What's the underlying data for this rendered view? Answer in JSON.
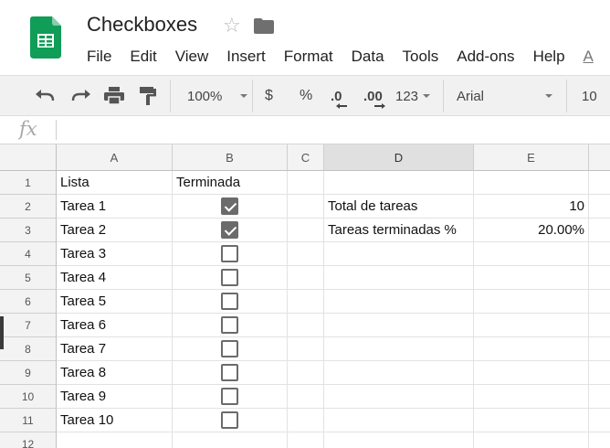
{
  "app": {
    "title": "Checkboxes",
    "menu": [
      "File",
      "Edit",
      "View",
      "Insert",
      "Format",
      "Data",
      "Tools",
      "Add-ons",
      "Help",
      "A"
    ]
  },
  "toolbar": {
    "zoom": "100%",
    "currency": "$",
    "percent": "%",
    "dec_decrease": ".0",
    "dec_increase": ".00",
    "number_format": "123",
    "font": "Arial",
    "font_size": "10"
  },
  "formula_bar": {
    "fx_label": "fx",
    "value": ""
  },
  "columns": [
    "A",
    "B",
    "C",
    "D",
    "E"
  ],
  "selected_column": "D",
  "rows": [
    {
      "num": "1",
      "a": "Lista",
      "b_text": "Terminada",
      "checkbox": null,
      "d": "",
      "e": ""
    },
    {
      "num": "2",
      "a": "Tarea 1",
      "b_text": "",
      "checkbox": true,
      "d": "Total de tareas",
      "e": "10"
    },
    {
      "num": "3",
      "a": "Tarea 2",
      "b_text": "",
      "checkbox": true,
      "d": "Tareas terminadas %",
      "e": "20.00%"
    },
    {
      "num": "4",
      "a": "Tarea 3",
      "b_text": "",
      "checkbox": false,
      "d": "",
      "e": ""
    },
    {
      "num": "5",
      "a": "Tarea 4",
      "b_text": "",
      "checkbox": false,
      "d": "",
      "e": ""
    },
    {
      "num": "6",
      "a": "Tarea 5",
      "b_text": "",
      "checkbox": false,
      "d": "",
      "e": ""
    },
    {
      "num": "7",
      "a": "Tarea 6",
      "b_text": "",
      "checkbox": false,
      "d": "",
      "e": ""
    },
    {
      "num": "8",
      "a": "Tarea 7",
      "b_text": "",
      "checkbox": false,
      "d": "",
      "e": ""
    },
    {
      "num": "9",
      "a": "Tarea 8",
      "b_text": "",
      "checkbox": false,
      "d": "",
      "e": ""
    },
    {
      "num": "10",
      "a": "Tarea 9",
      "b_text": "",
      "checkbox": false,
      "d": "",
      "e": ""
    },
    {
      "num": "11",
      "a": "Tarea 10",
      "b_text": "",
      "checkbox": false,
      "d": "",
      "e": ""
    },
    {
      "num": "12",
      "a": "",
      "b_text": "",
      "checkbox": null,
      "d": "",
      "e": ""
    }
  ],
  "colors": {
    "sheets_green": "#0f9d58",
    "checkbox_gray": "#6b6b6b",
    "header_bg": "#f3f3f3"
  }
}
